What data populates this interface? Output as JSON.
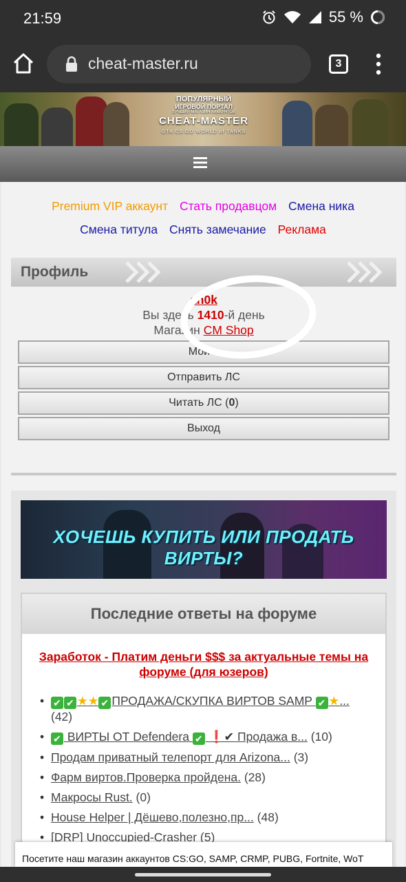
{
  "status_bar": {
    "time": "21:59",
    "battery_percent": "55 %",
    "icons": [
      "alarm-icon",
      "wifi-icon",
      "signal-icon",
      "battery-icon"
    ]
  },
  "browser": {
    "url": "cheat-master.ru",
    "tab_count": "3"
  },
  "banner": {
    "line1": "ПОПУЛЯРНЫЙ",
    "line2": "ИГРОВОЙ ПОРТАЛ",
    "line3": "ЛУЧШИЙ МАГАЗИН АККАУНТОВ",
    "logo": "CHEAT-MASTER",
    "games": "GTA   CS:GO   WORLD of TANKS"
  },
  "top_links": [
    {
      "label": "Premium VIP аккаунт",
      "color": "#f29a00"
    },
    {
      "label": "Стать продавцом",
      "color": "#e600e6"
    },
    {
      "label": "Смена ника",
      "color": "#1a1aa6"
    },
    {
      "label": "Смена титула",
      "color": "#1a1aa6"
    },
    {
      "label": "Снять замечание",
      "color": "#1a1aa6"
    },
    {
      "label": "Реклама",
      "color": "#e00000"
    }
  ],
  "profile": {
    "title": "Профиль",
    "username": "an0k",
    "days_prefix": "Вы здесь ",
    "days_value": "1410",
    "days_suffix": "-й день",
    "shop_prefix": "Магазин ",
    "shop_link": "CM Shop",
    "buttons": [
      "Мой п",
      "Отправить ЛС",
      "Читать ЛС (",
      "0",
      ")",
      "Выход"
    ]
  },
  "ad_banner": {
    "text": "ХОЧЕШЬ КУПИТЬ ИЛИ ПРОДАТЬ ВИРТЫ?"
  },
  "forum": {
    "title": "Последние ответы на форуме",
    "promo": "Заработок - Платим деньги $$$ за актуальные темы на форуме (для юзеров)",
    "posts": [
      {
        "title": "ПРОДАЖА/СКУПКА ВИРТОВ SAMP",
        "title2": "...",
        "count": "(42)"
      },
      {
        "title": "ВИРТЫ ОТ Defendera",
        "title2": "Продажа в...",
        "count": "(10)"
      },
      {
        "title": "Продам приватный телепорт для Arizona...",
        "count": "(3)"
      },
      {
        "title": "Фарм виртов.Проверка пройдена.",
        "count": "(28)"
      },
      {
        "title": "Макросы Rust.",
        "count": "(0)"
      },
      {
        "title": "House Helper | Дёшево,полезно,пр...",
        "count": "(48)"
      },
      {
        "title": "[DRP] Unoccupied-Crasher",
        "count": "(5)"
      }
    ]
  },
  "toast": {
    "text": "Посетите наш магазин аккаунтов CS:GO, SAMP, CRMP, PUBG, Fortnite, WoT"
  }
}
